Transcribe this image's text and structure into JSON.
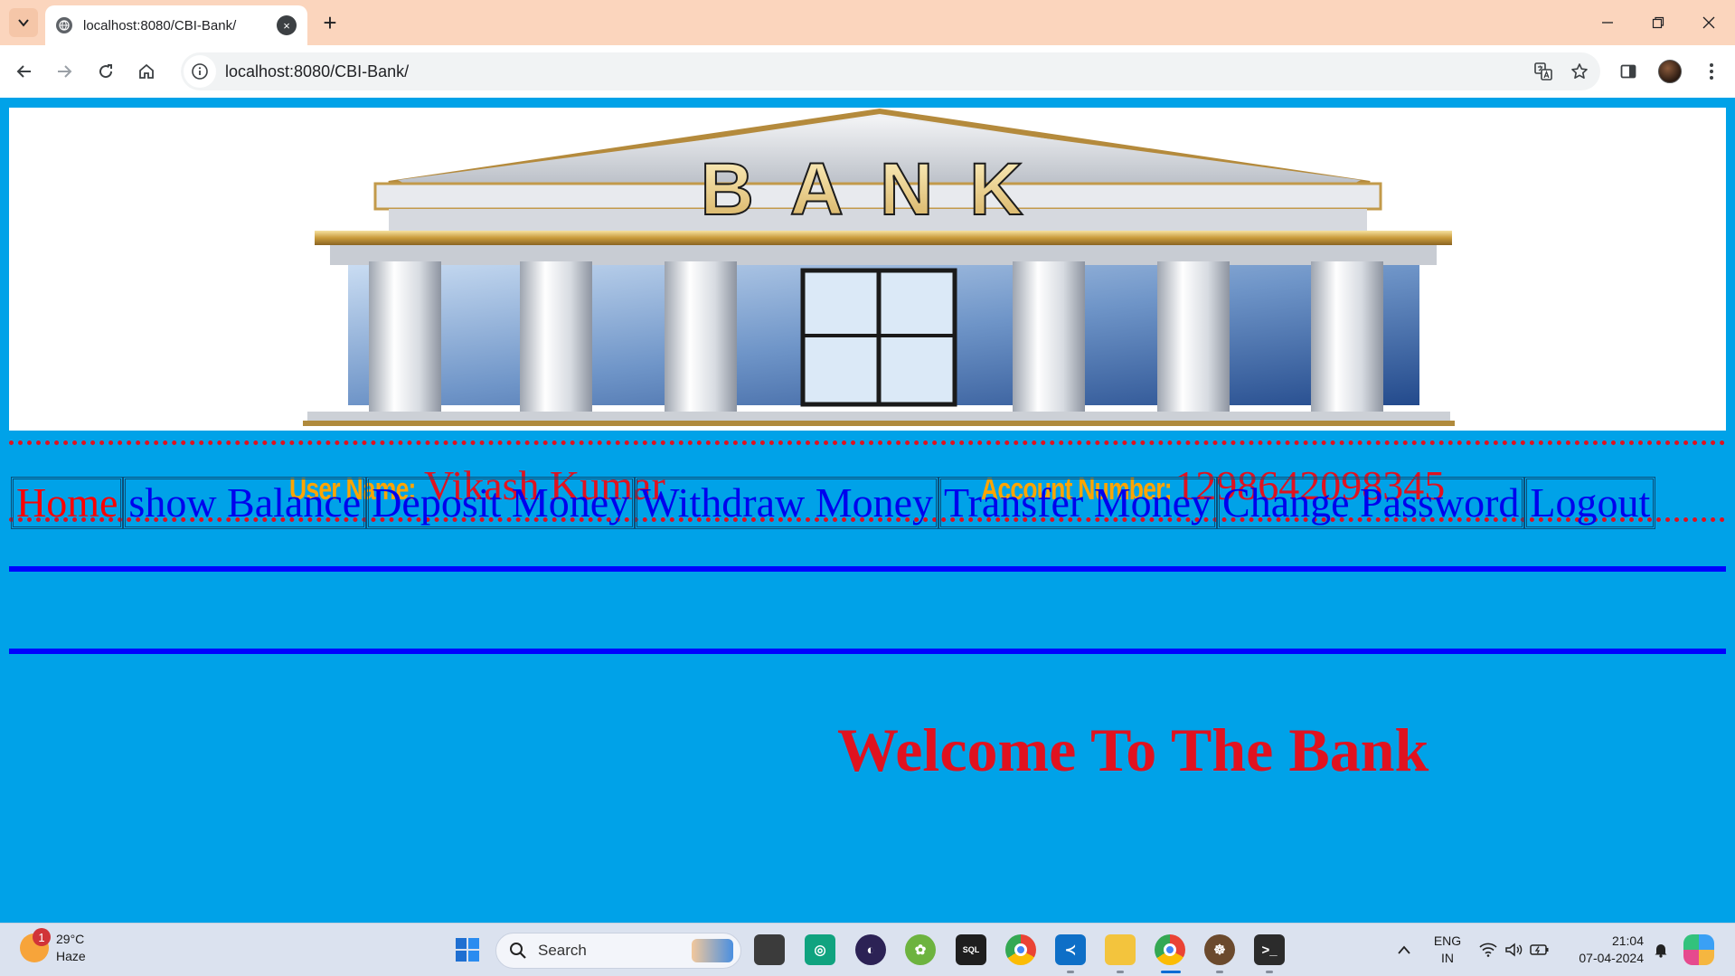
{
  "browser": {
    "tab_title": "localhost:8080/CBI-Bank/",
    "tab_close_icon": "×",
    "new_tab_icon": "+",
    "url": "localhost:8080/CBI-Bank/"
  },
  "banner": {
    "sign_text": "BANK"
  },
  "user_info": {
    "name_label": "User Name:",
    "name_value": "Vikash Kumar",
    "account_label": "Account Number:",
    "account_value": "1298642098345"
  },
  "nav": {
    "items": [
      {
        "label": "Home",
        "active": true
      },
      {
        "label": "show Balance"
      },
      {
        "label": "Deposit Money"
      },
      {
        "label": "Withdraw Money"
      },
      {
        "label": "Transfer Money"
      },
      {
        "label": "Change Password"
      },
      {
        "label": "Logout"
      }
    ]
  },
  "main": {
    "welcome": "Welcome To The Bank"
  },
  "taskbar": {
    "weather": {
      "badge": "1",
      "temp": "29°C",
      "condition": "Haze"
    },
    "search_label": "Search",
    "lang_line1": "ENG",
    "lang_line2": "IN",
    "time": "21:04",
    "date": "07-04-2024"
  },
  "colors": {
    "page_bg": "#00a2e8",
    "label_orange": "#ffa500",
    "value_red": "#e0121f",
    "link_blue": "#0000ee",
    "active_red": "#ff0000",
    "rule_blue": "#0000ff"
  }
}
